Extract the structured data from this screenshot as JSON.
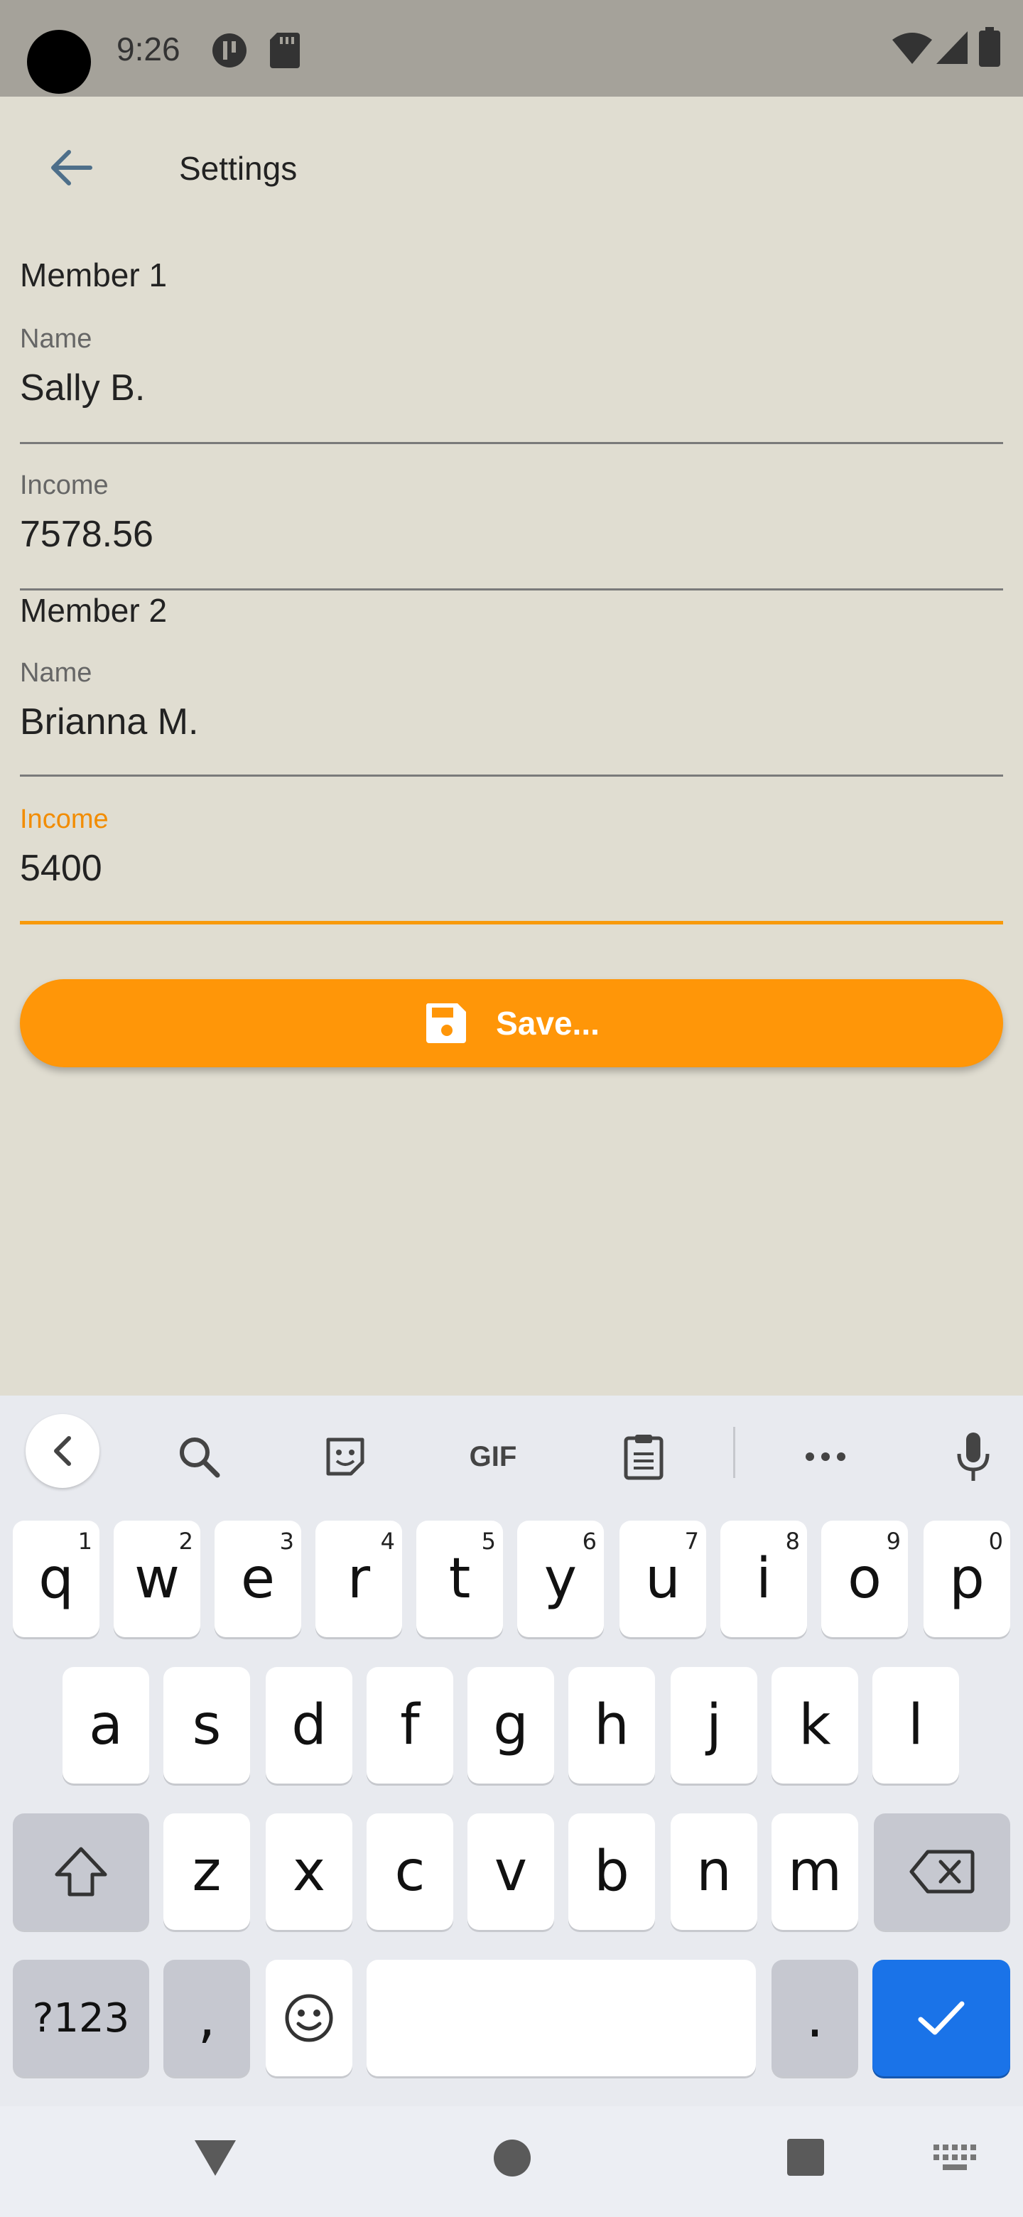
{
  "status_bar": {
    "time": "9:26"
  },
  "header": {
    "title": "Settings"
  },
  "members": [
    {
      "title": "Member 1",
      "name_label": "Name",
      "name_value": "Sally B.",
      "income_label": "Income",
      "income_value": "7578.56"
    },
    {
      "title": "Member 2",
      "name_label": "Name",
      "name_value": "Brianna M.",
      "income_label": "Income",
      "income_value": "5400"
    }
  ],
  "save_button": {
    "label": "Save..."
  },
  "colors": {
    "accent": "#FF9608",
    "background": "#E0DDD1",
    "enter_key": "#1A73E8"
  },
  "keyboard": {
    "toolbar": [
      "chevron-left-icon",
      "search-icon",
      "sticker-icon",
      "gif-icon",
      "clipboard-icon",
      "more-icon",
      "mic-icon"
    ],
    "gif_label": "GIF",
    "row1": [
      "q",
      "w",
      "e",
      "r",
      "t",
      "y",
      "u",
      "i",
      "o",
      "p"
    ],
    "row1_hints": [
      "1",
      "2",
      "3",
      "4",
      "5",
      "6",
      "7",
      "8",
      "9",
      "0"
    ],
    "row2": [
      "a",
      "s",
      "d",
      "f",
      "g",
      "h",
      "j",
      "k",
      "l"
    ],
    "row3": [
      "z",
      "x",
      "c",
      "v",
      "b",
      "n",
      "m"
    ],
    "symbols_label": "?123",
    "comma": ",",
    "period": "."
  }
}
